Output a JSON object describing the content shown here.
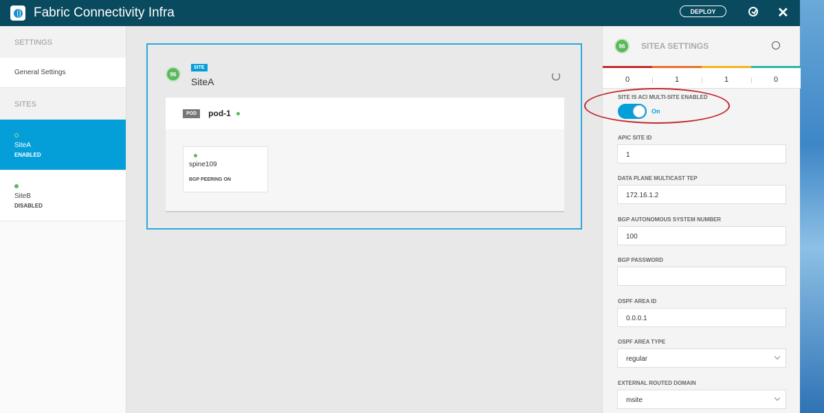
{
  "header": {
    "title": "Fabric Connectivity Infra",
    "deploy_label": "DEPLOY",
    "close_glyph": "✕",
    "icons": [
      "globe-icon",
      "refresh-icon",
      "close-icon"
    ]
  },
  "sidebar": {
    "settings_header": "SETTINGS",
    "general_settings": "General Settings",
    "sites_header": "SITES",
    "sites": [
      {
        "name": "SiteA",
        "status": "ENABLED",
        "active": true
      },
      {
        "name": "SiteB",
        "status": "DISABLED",
        "active": false
      }
    ]
  },
  "site_card": {
    "health_score": "96",
    "tag": "SITE",
    "name": "SiteA",
    "pod": {
      "tag": "POD",
      "name": "pod-1",
      "spine": {
        "name": "spine109",
        "status": "BGP PEERING ON"
      }
    }
  },
  "settings": {
    "health_score": "96",
    "title": "SITEA SETTINGS",
    "severity_colors": [
      "#c0282d",
      "#e8702a",
      "#f3b21a",
      "#2bb3a6"
    ],
    "fault_counts": [
      "0",
      "1",
      "1",
      "0"
    ],
    "multisite_label": "SITE IS ACI MULTI-SITE ENABLED",
    "multisite_toggle": "On",
    "fields": {
      "apic_site_id": {
        "label": "APIC SITE ID",
        "value": "1"
      },
      "multicast_tep": {
        "label": "DATA PLANE MULTICAST TEP",
        "value": "172.16.1.2"
      },
      "bgp_asn": {
        "label": "BGP AUTONOMOUS SYSTEM NUMBER",
        "value": "100"
      },
      "bgp_password": {
        "label": "BGP PASSWORD",
        "value": ""
      },
      "ospf_area_id": {
        "label": "OSPF AREA ID",
        "value": "0.0.0.1"
      },
      "ospf_area_type": {
        "label": "OSPF AREA TYPE",
        "value": "regular"
      },
      "external_routed_domain": {
        "label": "EXTERNAL ROUTED DOMAIN",
        "value": "msite"
      }
    }
  },
  "colors": {
    "header_bg": "#0a4a5e",
    "accent": "#049fd9",
    "health_green": "#5cb85c",
    "annotation_red": "#c0282d"
  }
}
